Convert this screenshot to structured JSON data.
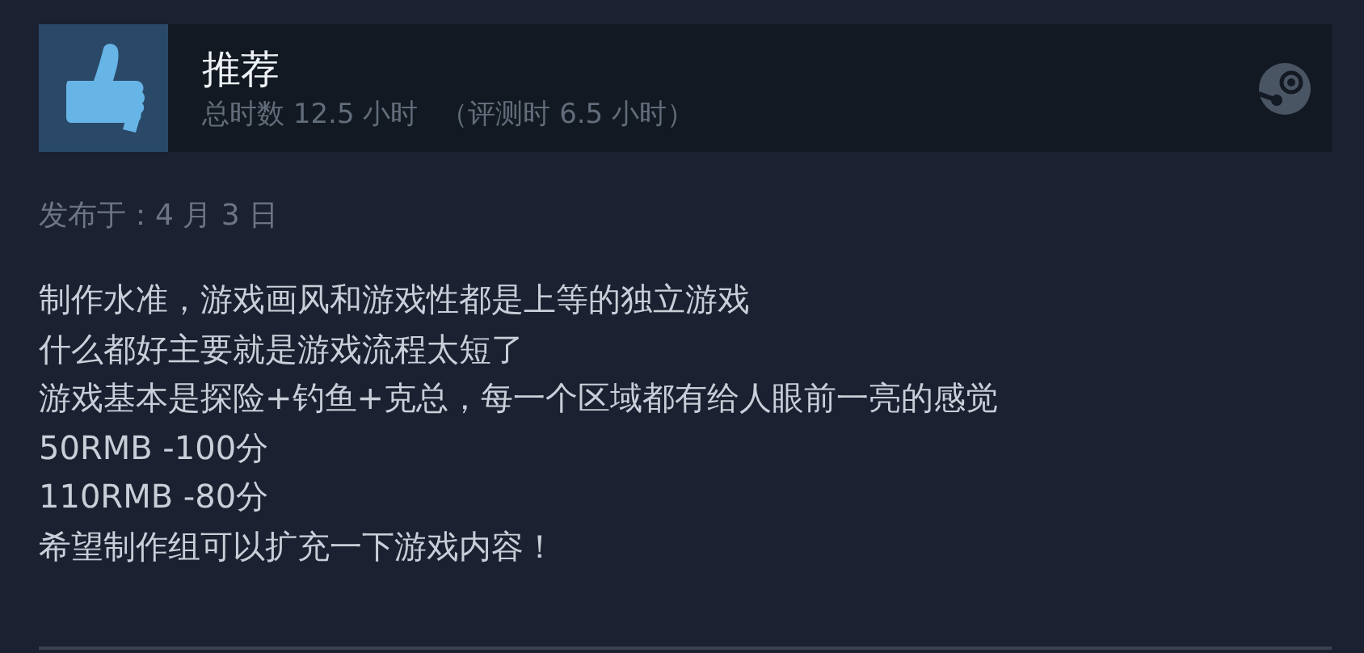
{
  "review": {
    "recommended": true,
    "title": "推荐",
    "hours_total": "总时数 12.5 小时",
    "hours_at_review": "（评测时 6.5 小时）"
  },
  "posted": "发布于：4 月 3 日",
  "body": [
    "制作水准，游戏画风和游戏性都是上等的独立游戏",
    "什么都好主要就是游戏流程太短了",
    "游戏基本是探险+钓鱼+克总，每一个区域都有给人眼前一亮的感觉",
    "50RMB -100分",
    "110RMB -80分",
    "希望制作组可以扩充一下游戏内容！"
  ]
}
